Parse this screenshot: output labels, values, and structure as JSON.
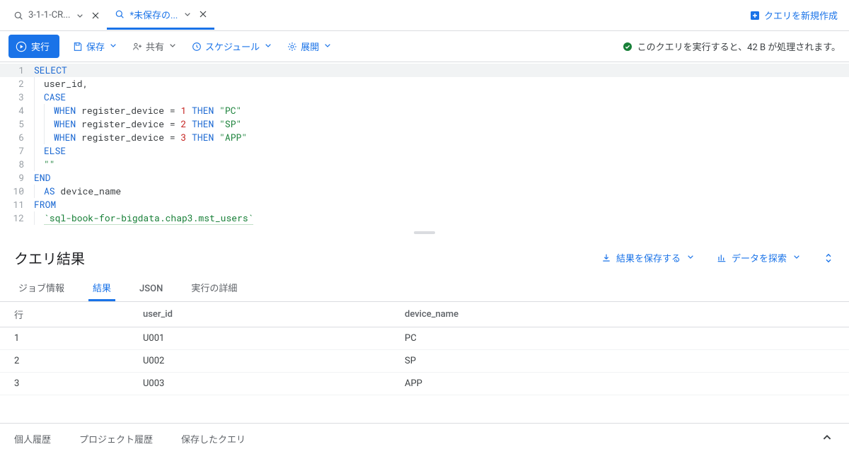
{
  "tabs": [
    {
      "label": "3-1-1-CR...",
      "active": false
    },
    {
      "label": "*未保存の...",
      "active": true
    }
  ],
  "newQueryLabel": "クエリを新規作成",
  "toolbar": {
    "run": "実行",
    "save": "保存",
    "share": "共有",
    "schedule": "スケジュール",
    "expand": "展開"
  },
  "statusText": "このクエリを実行すると、42 B が処理されます。",
  "editor": {
    "lines": [
      {
        "n": 1,
        "tokens": [
          {
            "t": "SELECT",
            "c": "kw"
          }
        ]
      },
      {
        "n": 2,
        "indent": 1,
        "tokens": [
          {
            "t": "user_id,",
            "c": "code"
          }
        ]
      },
      {
        "n": 3,
        "indent": 1,
        "tokens": [
          {
            "t": "CASE",
            "c": "kw"
          }
        ]
      },
      {
        "n": 4,
        "indent": 2,
        "tokens": [
          {
            "t": "WHEN",
            "c": "kw"
          },
          {
            "t": " register_device ",
            "c": "code"
          },
          {
            "t": "=",
            "c": "code"
          },
          {
            "t": " ",
            "c": "code"
          },
          {
            "t": "1",
            "c": "num"
          },
          {
            "t": " ",
            "c": "code"
          },
          {
            "t": "THEN",
            "c": "kw"
          },
          {
            "t": " ",
            "c": "code"
          },
          {
            "t": "\"PC\"",
            "c": "str"
          }
        ]
      },
      {
        "n": 5,
        "indent": 2,
        "tokens": [
          {
            "t": "WHEN",
            "c": "kw"
          },
          {
            "t": " register_device ",
            "c": "code"
          },
          {
            "t": "=",
            "c": "code"
          },
          {
            "t": " ",
            "c": "code"
          },
          {
            "t": "2",
            "c": "num"
          },
          {
            "t": " ",
            "c": "code"
          },
          {
            "t": "THEN",
            "c": "kw"
          },
          {
            "t": " ",
            "c": "code"
          },
          {
            "t": "\"SP\"",
            "c": "str"
          }
        ]
      },
      {
        "n": 6,
        "indent": 2,
        "tokens": [
          {
            "t": "WHEN",
            "c": "kw"
          },
          {
            "t": " register_device ",
            "c": "code"
          },
          {
            "t": "=",
            "c": "code"
          },
          {
            "t": " ",
            "c": "code"
          },
          {
            "t": "3",
            "c": "num"
          },
          {
            "t": " ",
            "c": "code"
          },
          {
            "t": "THEN",
            "c": "kw"
          },
          {
            "t": " ",
            "c": "code"
          },
          {
            "t": "\"APP\"",
            "c": "str"
          }
        ]
      },
      {
        "n": 7,
        "indent": 1,
        "tokens": [
          {
            "t": "ELSE",
            "c": "kw"
          }
        ]
      },
      {
        "n": 8,
        "indent": 1,
        "tokens": [
          {
            "t": "\"\"",
            "c": "str"
          }
        ]
      },
      {
        "n": 9,
        "indent": 0,
        "tokens": [
          {
            "t": "END",
            "c": "kw"
          }
        ]
      },
      {
        "n": 10,
        "indent": 1,
        "tokens": [
          {
            "t": "AS",
            "c": "kw"
          },
          {
            "t": " device_name",
            "c": "code"
          }
        ]
      },
      {
        "n": 11,
        "indent": 0,
        "tokens": [
          {
            "t": "FROM",
            "c": "kw"
          }
        ]
      },
      {
        "n": 12,
        "indent": 1,
        "tokens": [
          {
            "t": "`sql-book-for-bigdata.chap3.mst_users`",
            "c": "tbl"
          }
        ]
      }
    ]
  },
  "results": {
    "title": "クエリ結果",
    "saveResults": "結果を保存する",
    "explore": "データを探索",
    "tabs": [
      "ジョブ情報",
      "結果",
      "JSON",
      "実行の詳細"
    ],
    "activeTab": 1,
    "columns": [
      "行",
      "user_id",
      "device_name"
    ],
    "rows": [
      {
        "n": "1",
        "user_id": "U001",
        "device_name": "PC"
      },
      {
        "n": "2",
        "user_id": "U002",
        "device_name": "SP"
      },
      {
        "n": "3",
        "user_id": "U003",
        "device_name": "APP"
      }
    ]
  },
  "bottom": {
    "personal": "個人履歴",
    "project": "プロジェクト履歴",
    "saved": "保存したクエリ"
  }
}
